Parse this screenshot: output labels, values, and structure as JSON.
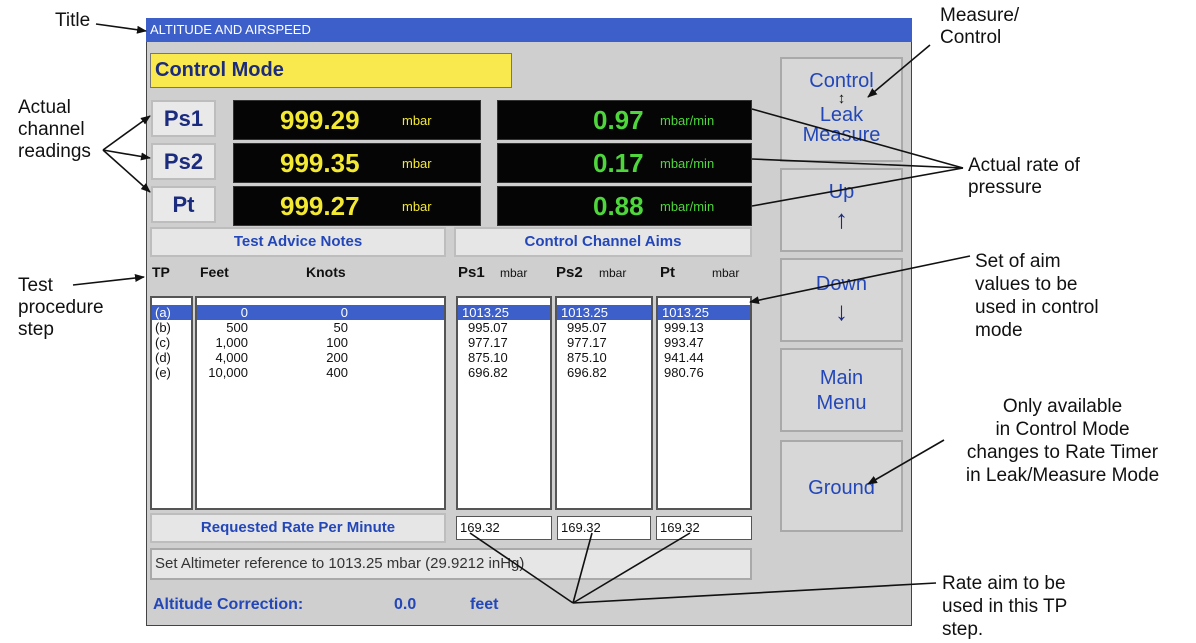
{
  "window": {
    "title": "ALTITUDE AND AIRSPEED"
  },
  "mode_label": "Control Mode",
  "channels": [
    {
      "label": "Ps1",
      "value": "999.29",
      "unit": "mbar",
      "rate": "0.97",
      "rate_unit": "mbar/min"
    },
    {
      "label": "Ps2",
      "value": "999.35",
      "unit": "mbar",
      "rate": "0.17",
      "rate_unit": "mbar/min"
    },
    {
      "label": "Pt",
      "value": "999.27",
      "unit": "mbar",
      "rate": "0.88",
      "rate_unit": "mbar/min"
    }
  ],
  "sections": {
    "advice": "Test Advice Notes",
    "aims": "Control Channel Aims"
  },
  "columns": {
    "tp": "TP",
    "feet": "Feet",
    "knots": "Knots",
    "ps1": "Ps1",
    "ps2": "Ps2",
    "pt": "Pt",
    "unit": "mbar"
  },
  "rows": [
    {
      "tp": "(a)",
      "feet": "0",
      "knots": "0",
      "ps1": "1013.25",
      "ps2": "1013.25",
      "pt": "1013.25"
    },
    {
      "tp": "(b)",
      "feet": "500",
      "knots": "50",
      "ps1": "995.07",
      "ps2": "995.07",
      "pt": "999.13"
    },
    {
      "tp": "(c)",
      "feet": "1,000",
      "knots": "100",
      "ps1": "977.17",
      "ps2": "977.17",
      "pt": "993.47"
    },
    {
      "tp": "(d)",
      "feet": "4,000",
      "knots": "200",
      "ps1": "875.10",
      "ps2": "875.10",
      "pt": "941.44"
    },
    {
      "tp": "(e)",
      "feet": "10,000",
      "knots": "400",
      "ps1": "696.82",
      "ps2": "696.82",
      "pt": "980.76"
    }
  ],
  "selected_row": 0,
  "rate": {
    "label": "Requested Rate Per Minute",
    "ps1": "169.32",
    "ps2": "169.32",
    "pt": "169.32"
  },
  "message": "Set Altimeter reference to 1013.25 mbar (29.9212 inHg)",
  "correction": {
    "label": "Altitude Correction:",
    "value": "0.0",
    "unit": "feet"
  },
  "buttons": {
    "control_top": "Control",
    "control_arrow": "↕",
    "control_leak": "Leak",
    "control_measure": "Measure",
    "up": "Up",
    "up_arrow": "↑",
    "down": "Down",
    "down_arrow": "↓",
    "main_line1": "Main",
    "main_line2": "Menu",
    "ground": "Ground"
  },
  "annotations": {
    "title": "Title",
    "measure_control": [
      "Measure/",
      "Control"
    ],
    "actual_channel": [
      "Actual",
      "channel",
      "readings"
    ],
    "rate_of_pressure": [
      "Actual rate of",
      "pressure"
    ],
    "test_procedure": [
      "Test",
      "procedure",
      "step"
    ],
    "aim_values": [
      "Set of aim",
      "values to be",
      "used in control",
      "mode"
    ],
    "only_available": [
      "Only available",
      "in Control Mode",
      "changes to Rate Timer",
      "in Leak/Measure Mode"
    ],
    "rate_aim": [
      "Rate aim to be",
      "used in this TP",
      "step."
    ]
  },
  "colors": {
    "titlebar": "#3d5fc9",
    "mode_bg": "#f9e94f",
    "reading": "#f3e832",
    "rate": "#4ed63c",
    "label_blue": "#2347b8"
  }
}
